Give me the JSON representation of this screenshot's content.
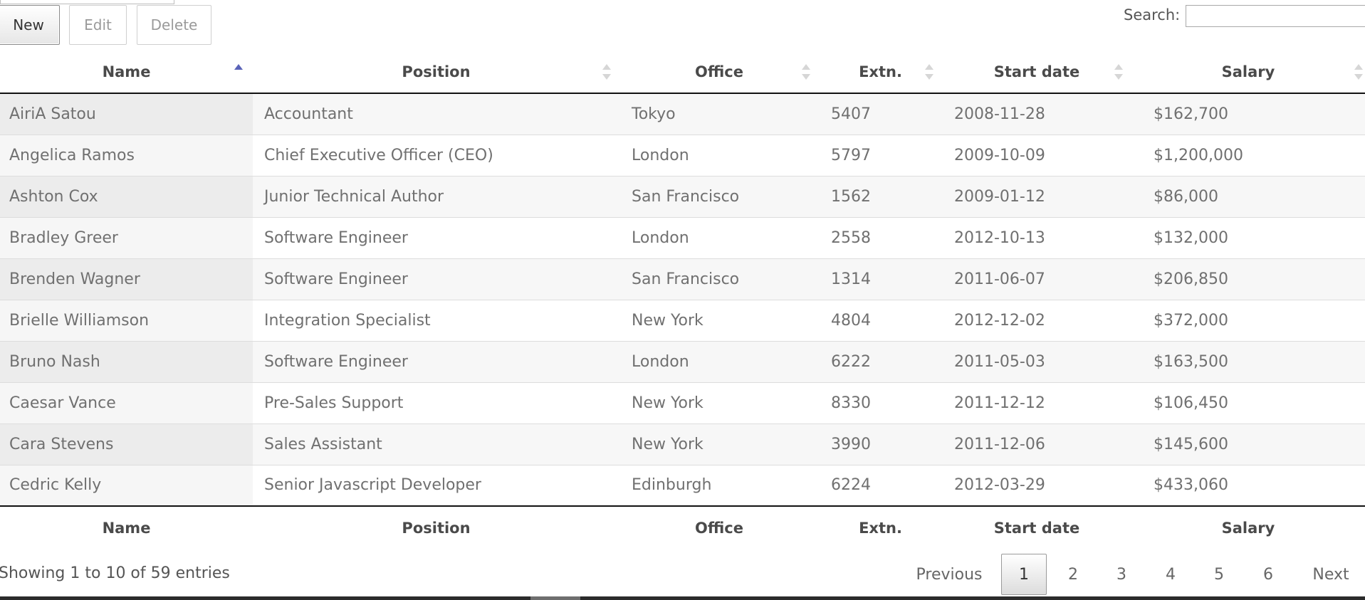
{
  "toolbar": {
    "new_label": "New",
    "edit_label": "Edit",
    "delete_label": "Delete"
  },
  "search": {
    "label": "Search:",
    "value": ""
  },
  "table": {
    "headers": {
      "name": "Name",
      "position": "Position",
      "office": "Office",
      "extn": "Extn.",
      "start_date": "Start date",
      "salary": "Salary"
    },
    "sorted_column": "name",
    "sort_direction": "ascending",
    "rows": [
      [
        "AiriA Satou",
        "Accountant",
        "Tokyo",
        "5407",
        "2008-11-28",
        "$162,700"
      ],
      [
        "Angelica Ramos",
        "Chief Executive Officer (CEO)",
        "London",
        "5797",
        "2009-10-09",
        "$1,200,000"
      ],
      [
        "Ashton Cox",
        "Junior Technical Author",
        "San Francisco",
        "1562",
        "2009-01-12",
        "$86,000"
      ],
      [
        "Bradley Greer",
        "Software Engineer",
        "London",
        "2558",
        "2012-10-13",
        "$132,000"
      ],
      [
        "Brenden Wagner",
        "Software Engineer",
        "San Francisco",
        "1314",
        "2011-06-07",
        "$206,850"
      ],
      [
        "Brielle Williamson",
        "Integration Specialist",
        "New York",
        "4804",
        "2012-12-02",
        "$372,000"
      ],
      [
        "Bruno Nash",
        "Software Engineer",
        "London",
        "6222",
        "2011-05-03",
        "$163,500"
      ],
      [
        "Caesar Vance",
        "Pre-Sales Support",
        "New York",
        "8330",
        "2011-12-12",
        "$106,450"
      ],
      [
        "Cara Stevens",
        "Sales Assistant",
        "New York",
        "3990",
        "2011-12-06",
        "$145,600"
      ],
      [
        "Cedric Kelly",
        "Senior Javascript Developer",
        "Edinburgh",
        "6224",
        "2012-03-29",
        "$433,060"
      ]
    ]
  },
  "info": {
    "text": "Showing 1 to 10 of 59 entries"
  },
  "pagination": {
    "previous": "Previous",
    "next": "Next",
    "pages": [
      "1",
      "2",
      "3",
      "4",
      "5",
      "6"
    ],
    "current": "1"
  },
  "colors": {
    "sort_active": "#5a63b8",
    "sort_inactive": "#d6d6d6",
    "header_rule": "#111111"
  }
}
